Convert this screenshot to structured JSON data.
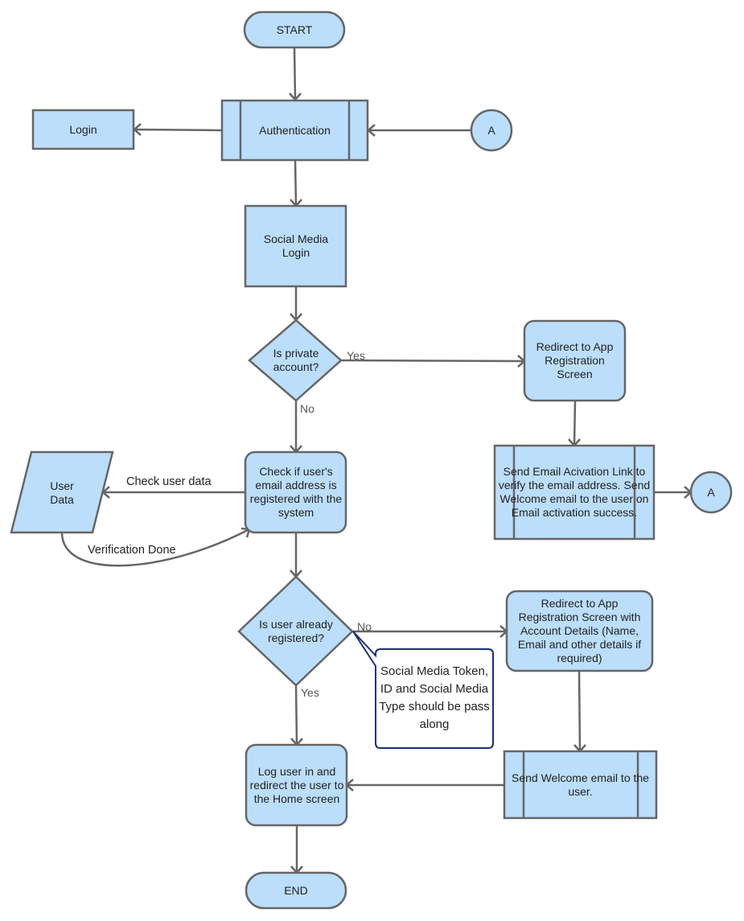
{
  "diagram": {
    "type": "flowchart",
    "colors": {
      "node_fill": "#bbdefb",
      "node_stroke": "#666666",
      "edge": "#666666",
      "callout_stroke": "#1a2f80",
      "callout_fill": "#ffffff"
    },
    "nodes": {
      "start": {
        "label": "START",
        "shape": "terminator"
      },
      "authentication": {
        "label": "Authentication",
        "shape": "predefined-process"
      },
      "login": {
        "label": "Login",
        "shape": "process"
      },
      "connector_a_top": {
        "label": "A",
        "shape": "connector"
      },
      "social_media_login": {
        "label": "Social Media Login",
        "shape": "process"
      },
      "is_private": {
        "label": "Is private account?",
        "shape": "decision"
      },
      "redirect_registration": {
        "label": "Redirect to App Registration Screen",
        "shape": "rounded-process"
      },
      "send_activation": {
        "label": "Send Email Acivation Link to verify the email address. Send Welcome email to the user on Email activation success.",
        "shape": "predefined-process"
      },
      "connector_a_right": {
        "label": "A",
        "shape": "connector"
      },
      "user_data": {
        "label": "User Data",
        "shape": "data"
      },
      "check_email": {
        "label": "Check if user's email address is registered with the system",
        "shape": "rounded-process"
      },
      "is_registered": {
        "label": "Is user already registered?",
        "shape": "decision"
      },
      "redirect_with_details": {
        "label": "Redirect to App Registration Screen with Account Details (Name, Email and other details if required)",
        "shape": "rounded-process"
      },
      "send_welcome": {
        "label": "Send Welcome email to the user.",
        "shape": "predefined-process"
      },
      "log_user_in": {
        "label": "Log user in and redirect the user to the Home screen",
        "shape": "rounded-process"
      },
      "end": {
        "label": "END",
        "shape": "terminator"
      }
    },
    "callout": {
      "text": "Social Media Token, ID and Social Media Type should be pass along",
      "attached_to": "is_registered"
    },
    "edges": [
      {
        "from": "start",
        "to": "authentication",
        "label": ""
      },
      {
        "from": "authentication",
        "to": "login",
        "label": ""
      },
      {
        "from": "connector_a_top",
        "to": "authentication",
        "label": ""
      },
      {
        "from": "authentication",
        "to": "social_media_login",
        "label": ""
      },
      {
        "from": "social_media_login",
        "to": "is_private",
        "label": ""
      },
      {
        "from": "is_private",
        "to": "redirect_registration",
        "label": "Yes"
      },
      {
        "from": "redirect_registration",
        "to": "send_activation",
        "label": ""
      },
      {
        "from": "send_activation",
        "to": "connector_a_right",
        "label": ""
      },
      {
        "from": "is_private",
        "to": "check_email",
        "label": "No"
      },
      {
        "from": "check_email",
        "to": "user_data",
        "label": "Check user data"
      },
      {
        "from": "user_data",
        "to": "check_email",
        "label": "Verification Done"
      },
      {
        "from": "check_email",
        "to": "is_registered",
        "label": ""
      },
      {
        "from": "is_registered",
        "to": "redirect_with_details",
        "label": "No"
      },
      {
        "from": "redirect_with_details",
        "to": "send_welcome",
        "label": ""
      },
      {
        "from": "send_welcome",
        "to": "log_user_in",
        "label": ""
      },
      {
        "from": "is_registered",
        "to": "log_user_in",
        "label": "Yes"
      },
      {
        "from": "log_user_in",
        "to": "end",
        "label": ""
      }
    ],
    "edge_labels": {
      "yes_private": "Yes",
      "no_private": "No",
      "check_user_data": "Check user data",
      "verification_done": "Verification Done",
      "no_registered": "No",
      "yes_registered": "Yes"
    }
  }
}
